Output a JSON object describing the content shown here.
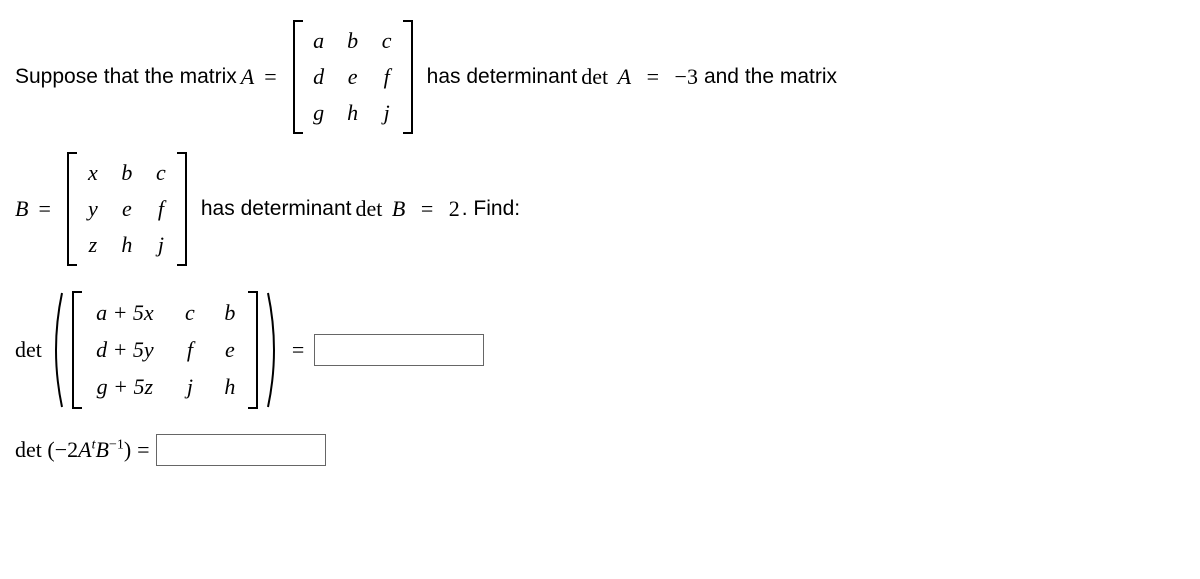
{
  "line1": {
    "prefix": "Suppose that the matrix ",
    "A": "A",
    "eq1": " = ",
    "matrixA": [
      [
        "a",
        "b",
        "c"
      ],
      [
        "d",
        "e",
        "f"
      ],
      [
        "g",
        "h",
        "j"
      ]
    ],
    "mid": " has determinant ",
    "detA_expr": "det A = −3",
    "detA_label": "det",
    "detA_var": "A",
    "detA_val": "−3",
    "suffix": "  and the matrix"
  },
  "line2": {
    "B": "B",
    "eq": " = ",
    "matrixB": [
      [
        "x",
        "b",
        "c"
      ],
      [
        "y",
        "e",
        "f"
      ],
      [
        "z",
        "h",
        "j"
      ]
    ],
    "mid": " has determinant ",
    "detB_label": "det",
    "detB_var": "B",
    "detB_val": "2",
    "suffix": ".  Find:"
  },
  "line3": {
    "det": "det",
    "matrixC": [
      [
        "a + 5x",
        "c",
        "b"
      ],
      [
        "d + 5y",
        "f",
        "e"
      ],
      [
        "g + 5z",
        "j",
        "h"
      ]
    ],
    "eq": " = ",
    "answer": ""
  },
  "line4": {
    "expr_det": "det",
    "expr_open": " (",
    "expr_neg2": "−2",
    "expr_A": "A",
    "expr_t": "t",
    "expr_B": "B",
    "expr_inv": "−1",
    "expr_close": ") ",
    "eq": "=",
    "answer": ""
  }
}
